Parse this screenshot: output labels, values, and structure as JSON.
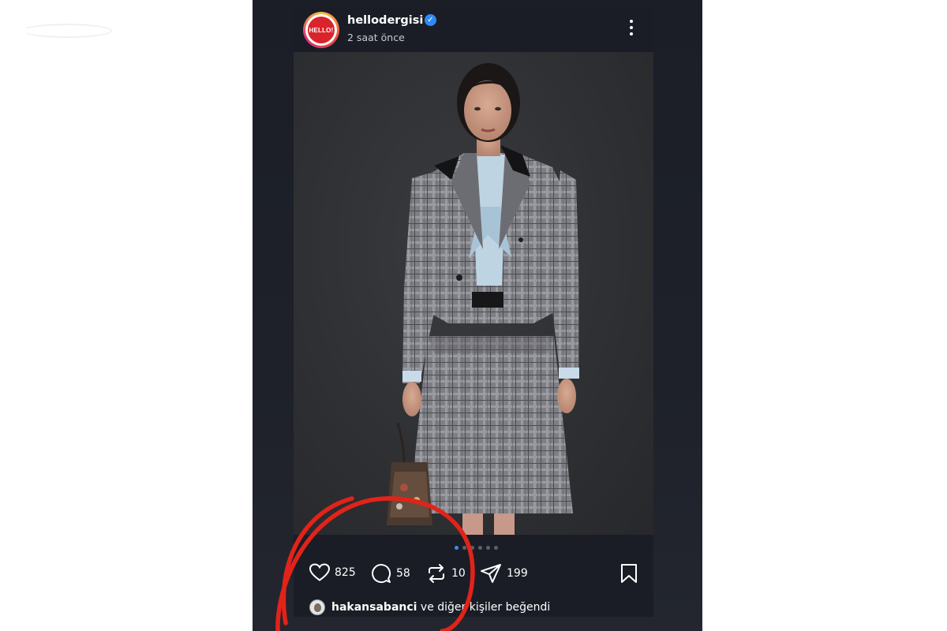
{
  "watermark": {
    "text": ""
  },
  "post": {
    "username": "hellodergisi",
    "avatar_text": "HELLO!",
    "verified_mark": "✓",
    "time_ago": "2 saat önce",
    "carousel": {
      "count": 6,
      "active_index": 0
    },
    "actions": {
      "likes": "825",
      "comments": "58",
      "reposts": "10",
      "shares": "199"
    },
    "liked_by": {
      "user": "hakansabanci",
      "suffix": " ve diğer kişiler beğendi"
    }
  },
  "colors": {
    "background": "#ffffff",
    "feed": "#1b1e27",
    "verified": "#2f8af5",
    "brand_red": "#d9242c",
    "annotation_red": "#e2231a",
    "active_dot": "#3d8bf2"
  },
  "icons": [
    "more-vertical-icon",
    "heart-icon",
    "comment-icon",
    "repost-icon",
    "send-icon",
    "bookmark-icon"
  ]
}
